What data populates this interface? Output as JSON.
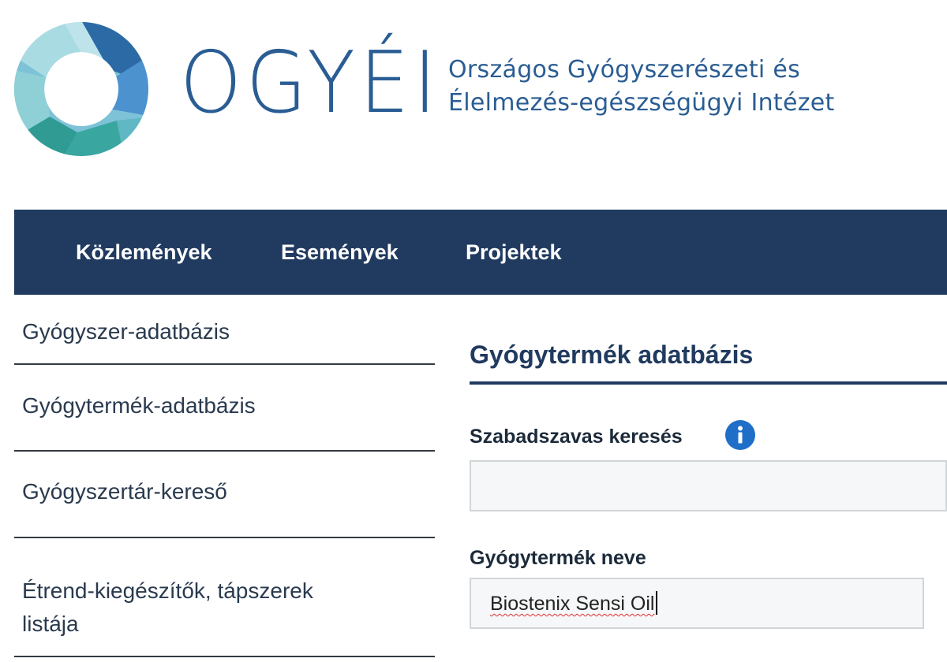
{
  "header": {
    "logo_word": "OGYÉI",
    "org_line1": "Országos Gyógyszerészeti és",
    "org_line2": "Élelmezés-egészségügyi Intézet",
    "colors": {
      "brand_blue": "#2a5d93",
      "teal": "#3aa6a0",
      "light_blue": "#6ba6d8"
    }
  },
  "nav": {
    "background": "#213a5f",
    "items": [
      {
        "label": "Közlemények"
      },
      {
        "label": "Események"
      },
      {
        "label": "Projektek"
      }
    ]
  },
  "sidebar": {
    "items": [
      {
        "label": "Gyógyszer-adatbázis"
      },
      {
        "label": "Gyógytermék-adatbázis"
      },
      {
        "label": "Gyógyszertár-kereső"
      },
      {
        "label": "Étrend-kiegészítők, tápszerek listája"
      }
    ]
  },
  "main": {
    "title": "Gyógytermék adatbázis",
    "freetext": {
      "label": "Szabadszavas keresés",
      "icon": "info-icon",
      "value": ""
    },
    "product_name": {
      "label": "Gyógytermék neve",
      "value": "Biostenix Sensi Oil"
    }
  }
}
